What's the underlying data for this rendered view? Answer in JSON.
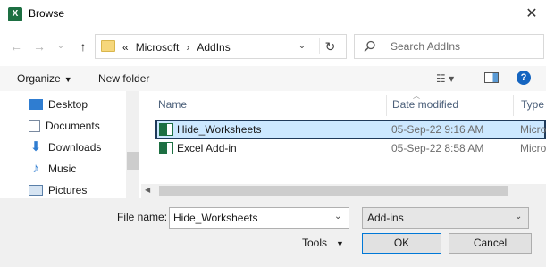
{
  "window": {
    "title": "Browse",
    "app_icon": "excel-icon",
    "close_glyph": "✕"
  },
  "nav": {
    "back_glyph": "←",
    "forward_glyph": "→",
    "dropdown_glyph": "⌄",
    "up_glyph": "↑"
  },
  "address": {
    "prefix": "«",
    "crumbs": [
      "Microsoft",
      "AddIns"
    ],
    "separator": "›",
    "dropdown_glyph": "⌄",
    "refresh_glyph": "↻"
  },
  "search": {
    "placeholder": "Search AddIns"
  },
  "toolbar": {
    "organize_label": "Organize",
    "new_folder_label": "New folder",
    "view_glyph": "☷ ▾",
    "help_glyph": "?"
  },
  "sidebar": {
    "items": [
      {
        "label": "Desktop",
        "icon": "desktop-icon",
        "color": "#2f7dd1"
      },
      {
        "label": "Documents",
        "icon": "documents-icon",
        "color": "#7a8aa0"
      },
      {
        "label": "Downloads",
        "icon": "downloads-icon",
        "color": "#2f7dd1"
      },
      {
        "label": "Music",
        "icon": "music-icon",
        "color": "#2f7dd1"
      },
      {
        "label": "Pictures",
        "icon": "pictures-icon",
        "color": "#5a7fa8"
      }
    ]
  },
  "file_list": {
    "columns": [
      "Name",
      "Date modified",
      "Type"
    ],
    "rows": [
      {
        "name": "Hide_Worksheets",
        "date": "05-Sep-22 9:16 AM",
        "type": "Micro",
        "selected": true
      },
      {
        "name": "Excel Add-in",
        "date": "05-Sep-22 8:58 AM",
        "type": "Micro",
        "selected": false
      }
    ]
  },
  "footer": {
    "file_name_label": "File name:",
    "file_name_value": "Hide_Worksheets",
    "file_type_value": "Add-ins",
    "tools_label": "Tools",
    "ok_label": "OK",
    "cancel_label": "Cancel"
  },
  "colors": {
    "accent": "#0078d7",
    "selection": "#cce8ff",
    "excel_green": "#1d6f42"
  }
}
